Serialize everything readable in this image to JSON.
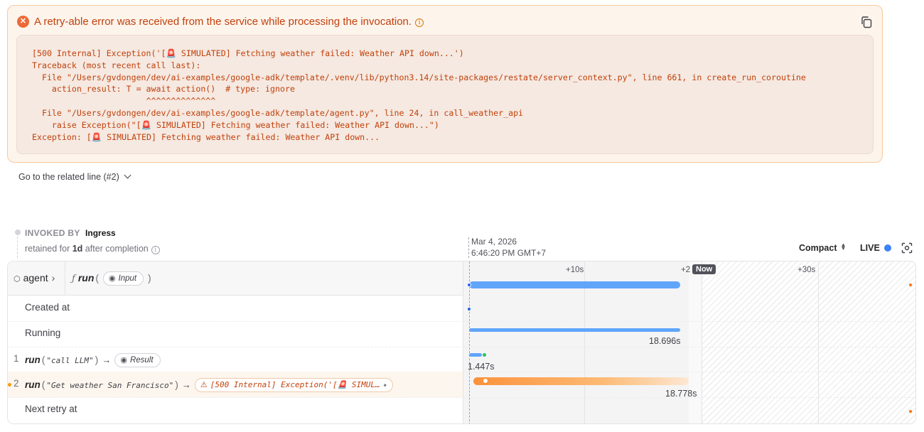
{
  "error": {
    "title": "A retry-able error was received from the service while processing the invocation.",
    "info_glyph": "i",
    "x_glyph": "✕",
    "trace_lines": [
      "[500 Internal] Exception('[🚨 SIMULATED] Fetching weather failed: Weather API down...')",
      "Traceback (most recent call last):",
      "  File \"/Users/gvdongen/dev/ai-examples/google-adk/template/.venv/lib/python3.14/site-packages/restate/server_context.py\", line 661, in create_run_coroutine",
      "    action_result: T = await action()  # type: ignore",
      "                       ^^^^^^^^^^^^^^",
      "  File \"/Users/gvdongen/dev/ai-examples/google-adk/template/agent.py\", line 24, in call_weather_api",
      "    raise Exception(\"[🚨 SIMULATED] Fetching weather failed: Weather API down...\")",
      "Exception: [🚨 SIMULATED] Fetching weather failed: Weather API down..."
    ]
  },
  "related_link": "Go to the related line (#2)",
  "invoked": {
    "label": "INVOKED BY",
    "value": "Ingress",
    "retained_prefix": "retained for",
    "retained_value": "1d",
    "retained_suffix": "after completion"
  },
  "timeline": {
    "date": "Mar 4, 2026",
    "time": "6:46:20 PM GMT+7",
    "ticks": [
      "+10s",
      "+2",
      "+30s"
    ],
    "now_label": "Now"
  },
  "controls": {
    "compact_label": "Compact",
    "live_label": "LIVE"
  },
  "header": {
    "service": "agent",
    "handler_glyph": "ƒ",
    "handler": "run",
    "input_label": "Input"
  },
  "rows": {
    "created_at": "Created at",
    "running": "Running",
    "running_duration": "18.696s",
    "step1_num": "1",
    "step1_name": "run",
    "step1_arg": "\"call LLM\"",
    "step1_result": "Result",
    "step1_duration": "1.447s",
    "step2_num": "2",
    "step2_name": "run",
    "step2_arg": "\"Get weather San Francisco\"",
    "step2_error": "[500 Internal] Exception('[🚨 SIMUL…",
    "step2_duration": "18.778s",
    "next_retry": "Next retry at"
  },
  "colors": {
    "accent_blue": "#60a5fa",
    "error_orange": "#ea580c",
    "error_bg": "#fdf4ec"
  },
  "icons": [
    "x-circle-icon",
    "info-icon",
    "copy-icon",
    "chevron-down-icon",
    "cube-icon",
    "chevron-right-icon",
    "eye-icon",
    "arrow-right-icon",
    "warning-icon",
    "focus-icon"
  ]
}
